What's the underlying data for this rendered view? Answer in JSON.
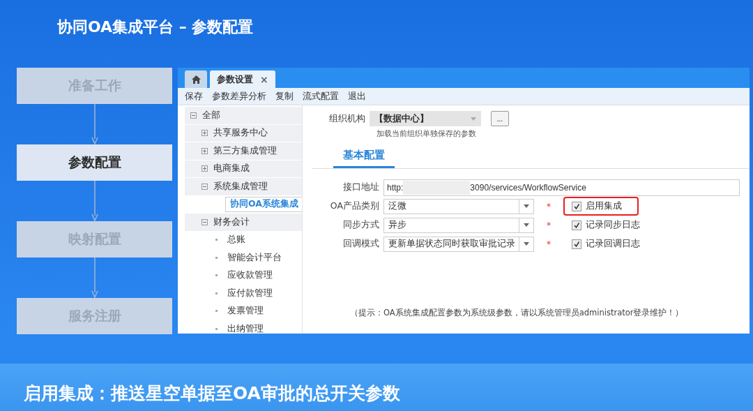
{
  "slide_title": "协同OA集成平台 – 参数配置",
  "steps": [
    {
      "label": "准备工作",
      "selected": false
    },
    {
      "label": "参数配置",
      "selected": true
    },
    {
      "label": "映射配置",
      "selected": false
    },
    {
      "label": "服务注册",
      "selected": false
    }
  ],
  "app": {
    "tabs": [
      {
        "kind": "home",
        "selected": false
      },
      {
        "kind": "text",
        "label": "参数设置",
        "close": "×",
        "selected": true
      }
    ],
    "toolbar": [
      "保存",
      "参数差异分析",
      "复制",
      "流式配置",
      "退出"
    ],
    "tree": [
      {
        "label": "全部",
        "expanded": true,
        "children": [
          {
            "label": "共享服务中心",
            "expanded": false
          },
          {
            "label": "第三方集成管理",
            "expanded": false
          },
          {
            "label": "电商集成",
            "expanded": false
          },
          {
            "label": "系统集成管理",
            "expanded": true,
            "children": [
              {
                "label": "协同OA系统集成",
                "selected": true
              }
            ]
          },
          {
            "label": "财务会计",
            "expanded": true,
            "children": [
              {
                "label": "总账",
                "selected": false
              },
              {
                "label": "智能会计平台",
                "selected": false
              },
              {
                "label": "应收款管理",
                "selected": false
              },
              {
                "label": "应付款管理",
                "selected": false
              },
              {
                "label": "发票管理",
                "selected": false
              },
              {
                "label": "出纳管理",
                "selected": false
              }
            ]
          }
        ]
      }
    ],
    "org": {
      "label": "组织机构",
      "value": "【数据中心】",
      "button": "...",
      "hint": "加载当前组织单独保存的参数"
    },
    "section_tabs": [
      {
        "label": "基本配置",
        "selected": true
      }
    ],
    "url": {
      "label": "接口地址",
      "value_start": "http:",
      "value_end": "3090/services/WorkflowService"
    },
    "rows": [
      {
        "label": "OA产品类别",
        "value": "泛微",
        "required": "*",
        "checkbox": {
          "label": "启用集成",
          "checked": true,
          "highlighted": true
        }
      },
      {
        "label": "同步方式",
        "value": "异步",
        "required": "*",
        "checkbox": {
          "label": "记录同步日志",
          "checked": true,
          "highlighted": false
        }
      },
      {
        "label": "回调模式",
        "value": "更新单据状态同时获取审批记录",
        "required": "*",
        "checkbox": {
          "label": "记录回调日志",
          "checked": true,
          "highlighted": false
        }
      }
    ],
    "note": "（提示：OA系统集成配置参数为系统级参数，请以系统管理员administrator登录维护！）"
  },
  "caption": "启用集成：推送星空单据至OA审批的总开关参数"
}
